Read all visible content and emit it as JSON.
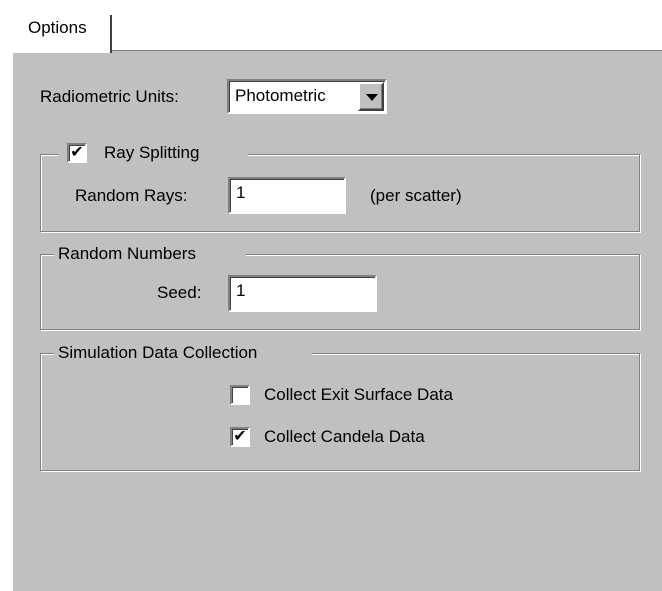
{
  "tab": {
    "label": "Options"
  },
  "radiometric": {
    "label": "Radiometric Units:",
    "value": "Photometric"
  },
  "ray_splitting": {
    "label": "Ray Splitting",
    "checked": true,
    "random_rays_label": "Random Rays:",
    "random_rays_value": "1",
    "suffix": "(per scatter)"
  },
  "random_numbers": {
    "label": "Random Numbers",
    "seed_label": "Seed:",
    "seed_value": "1"
  },
  "simulation": {
    "label": "Simulation Data Collection",
    "exit_surface": {
      "label": "Collect Exit Surface Data",
      "checked": false
    },
    "candela": {
      "label": "Collect Candela Data",
      "checked": true
    }
  },
  "check_glyph": "✔"
}
